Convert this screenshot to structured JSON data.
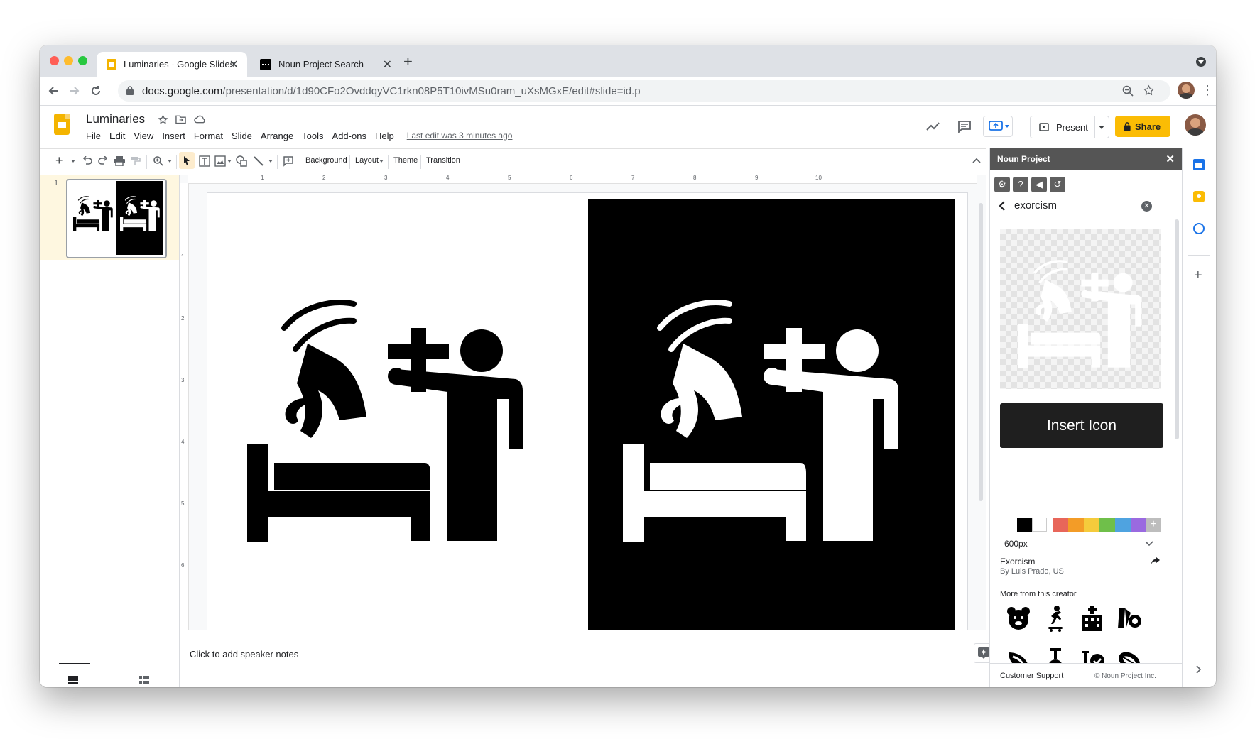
{
  "browser": {
    "tabs": [
      {
        "title": "Luminaries - Google Slides",
        "close": "✕"
      },
      {
        "title": "Noun Project Search",
        "close": "✕"
      }
    ],
    "new_tab": "+",
    "url_host": "docs.google.com",
    "url_path": "/presentation/d/1d90CFo2OvddqyVC1rkn08P5T10ivMSu0ram_uXsMGxE/edit#slide=id.p"
  },
  "doc": {
    "title": "Luminaries",
    "menu": [
      "File",
      "Edit",
      "View",
      "Insert",
      "Format",
      "Slide",
      "Arrange",
      "Tools",
      "Add-ons",
      "Help"
    ],
    "last_edit": "Last edit was 3 minutes ago",
    "present_label": "Present",
    "share_label": "Share"
  },
  "toolbar": {
    "background": "Background",
    "layout": "Layout",
    "theme": "Theme",
    "transition": "Transition"
  },
  "ruler": {
    "h_marks": [
      "1",
      "2",
      "3",
      "4",
      "5",
      "6",
      "7",
      "8",
      "9",
      "10"
    ],
    "v_marks": [
      "1",
      "2",
      "3",
      "4",
      "5",
      "6"
    ]
  },
  "filmstrip": {
    "slide_number": "1"
  },
  "notes": {
    "placeholder": "Click to add speaker notes"
  },
  "noun_project": {
    "header": "Noun Project",
    "search_term": "exorcism",
    "insert_label": "Insert Icon",
    "size": "600px",
    "icon_name": "Exorcism",
    "icon_author": "By Luis Prado, US",
    "more_label": "More from this creator",
    "support_link": "Customer Support",
    "copyright": "© Noun Project Inc.",
    "colors": [
      "#000000",
      "#ffffff",
      "#e8665a",
      "#f39c27",
      "#f5cb3c",
      "#6fbf4a",
      "#4fa3e0",
      "#9a6ae0"
    ],
    "creator_icons": [
      "bear-icon",
      "skateboarder-icon",
      "hospital-icon",
      "boot-icon",
      "seed-icon",
      "unicycle-icon",
      "syringe-check-icon",
      "leaf-icon"
    ]
  },
  "colors": {
    "slides_yellow": "#f4b400",
    "share_yellow": "#fbbc04",
    "panel_header": "#555555"
  }
}
